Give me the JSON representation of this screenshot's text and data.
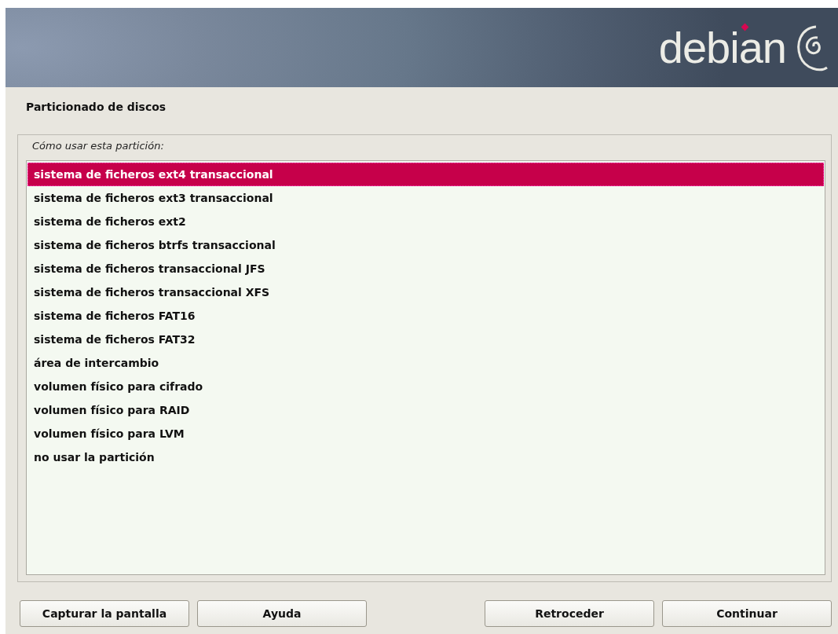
{
  "banner": {
    "logo": "debian"
  },
  "title": "Particionado de discos",
  "question": "Cómo usar esta partición:",
  "options": [
    {
      "label": "sistema de ficheros ext4 transaccional",
      "selected": true
    },
    {
      "label": "sistema de ficheros ext3 transaccional",
      "selected": false
    },
    {
      "label": "sistema de ficheros ext2",
      "selected": false
    },
    {
      "label": "sistema de ficheros btrfs transaccional",
      "selected": false
    },
    {
      "label": "sistema de ficheros transaccional JFS",
      "selected": false
    },
    {
      "label": "sistema de ficheros transaccional XFS",
      "selected": false
    },
    {
      "label": "sistema de ficheros FAT16",
      "selected": false
    },
    {
      "label": "sistema de ficheros FAT32",
      "selected": false
    },
    {
      "label": "área de intercambio",
      "selected": false
    },
    {
      "label": "volumen físico para cifrado",
      "selected": false
    },
    {
      "label": "volumen físico para RAID",
      "selected": false
    },
    {
      "label": "volumen físico para LVM",
      "selected": false
    },
    {
      "label": "no usar la partición",
      "selected": false
    }
  ],
  "buttons": {
    "left": [
      "Capturar la pantalla",
      "Ayuda"
    ],
    "right": [
      "Retroceder",
      "Continuar"
    ]
  }
}
